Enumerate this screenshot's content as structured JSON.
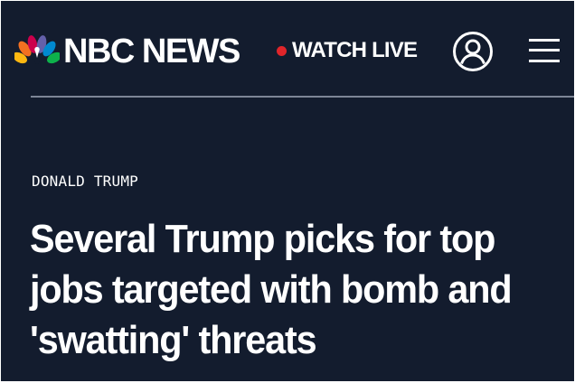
{
  "header": {
    "brand_name": "NBC NEWS",
    "watch_live_label": "WATCH LIVE",
    "live_dot_color": "#e0252a",
    "account_icon": "user-circle-icon",
    "menu_icon": "hamburger-menu-icon",
    "peacock_colors": [
      "#fcb711",
      "#f37021",
      "#cc004c",
      "#6460aa",
      "#0089d0",
      "#0db14b"
    ]
  },
  "article": {
    "category": "DONALD TRUMP",
    "headline_lines": [
      "Several Trump picks for top",
      "jobs targeted with bomb and",
      "'swatting' threats"
    ]
  },
  "theme": {
    "background": "#131c2e",
    "text": "#ffffff",
    "divider": "#7d8596"
  }
}
